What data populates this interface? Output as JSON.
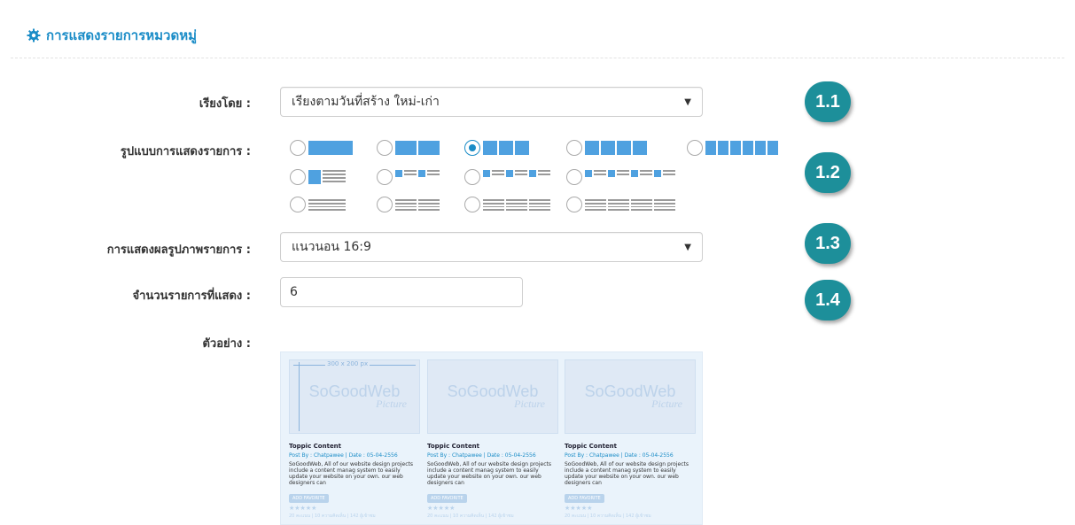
{
  "header": {
    "title": "การแสดงรายการหมวดหมู่",
    "icon": "gear-icon"
  },
  "colors": {
    "accent": "#1a8cc7",
    "badge": "#1d8f9a",
    "layout_block": "#4fa1e0"
  },
  "fields": {
    "sort": {
      "label": "เรียงโดย :",
      "value": "เรียงตามวันที่สร้าง ใหม่-เก่า"
    },
    "layout": {
      "label": "รูปแบบการแสดงรายการ :",
      "selected": "layout-3-columns"
    },
    "image": {
      "label": "การแสดงผลรูปภาพรายการ :",
      "value": "แนวนอน 16:9"
    },
    "count": {
      "label": "จำนวนรายการที่แสดง :",
      "value": "6"
    },
    "preview": {
      "label": "ตัวอย่าง :"
    }
  },
  "badges": [
    "1.1",
    "1.2",
    "1.3",
    "1.4"
  ],
  "preview": {
    "dimension": "300 x 200 px",
    "watermark": "SoGoodWeb",
    "watermark_sub": "Picture",
    "cards": [
      {
        "title": "Toppic Content",
        "meta": "Post By : Chatpawee  |  Date : 05-04-2556",
        "desc": "SoGoodWeb, All of our website design projects include a content manag system to easily update your website on your own. our web designers can",
        "fav": "ADD FAVORITE",
        "stars": "★★★★★",
        "foot": "20 คะแนน | 10 ความคิดเห็น | 142 ผู้เข้าชม"
      },
      {
        "title": "Toppic Content",
        "meta": "Post By : Chatpawee  |  Date : 05-04-2556",
        "desc": "SoGoodWeb, All of our website design projects include a content manag system to easily update your website on your own. our web designers can",
        "fav": "ADD FAVORITE",
        "stars": "★★★★★",
        "foot": "20 คะแนน | 10 ความคิดเห็น | 142 ผู้เข้าชม"
      },
      {
        "title": "Toppic Content",
        "meta": "Post By : Chatpawee  |  Date : 05-04-2556",
        "desc": "SoGoodWeb, All of our website design projects include a content manag system to easily update your website on your own. our web designers can",
        "fav": "ADD FAVORITE",
        "stars": "★★★★★",
        "foot": "20 คะแนน | 10 ความคิดเห็น | 142 ผู้เข้าชม"
      }
    ]
  }
}
